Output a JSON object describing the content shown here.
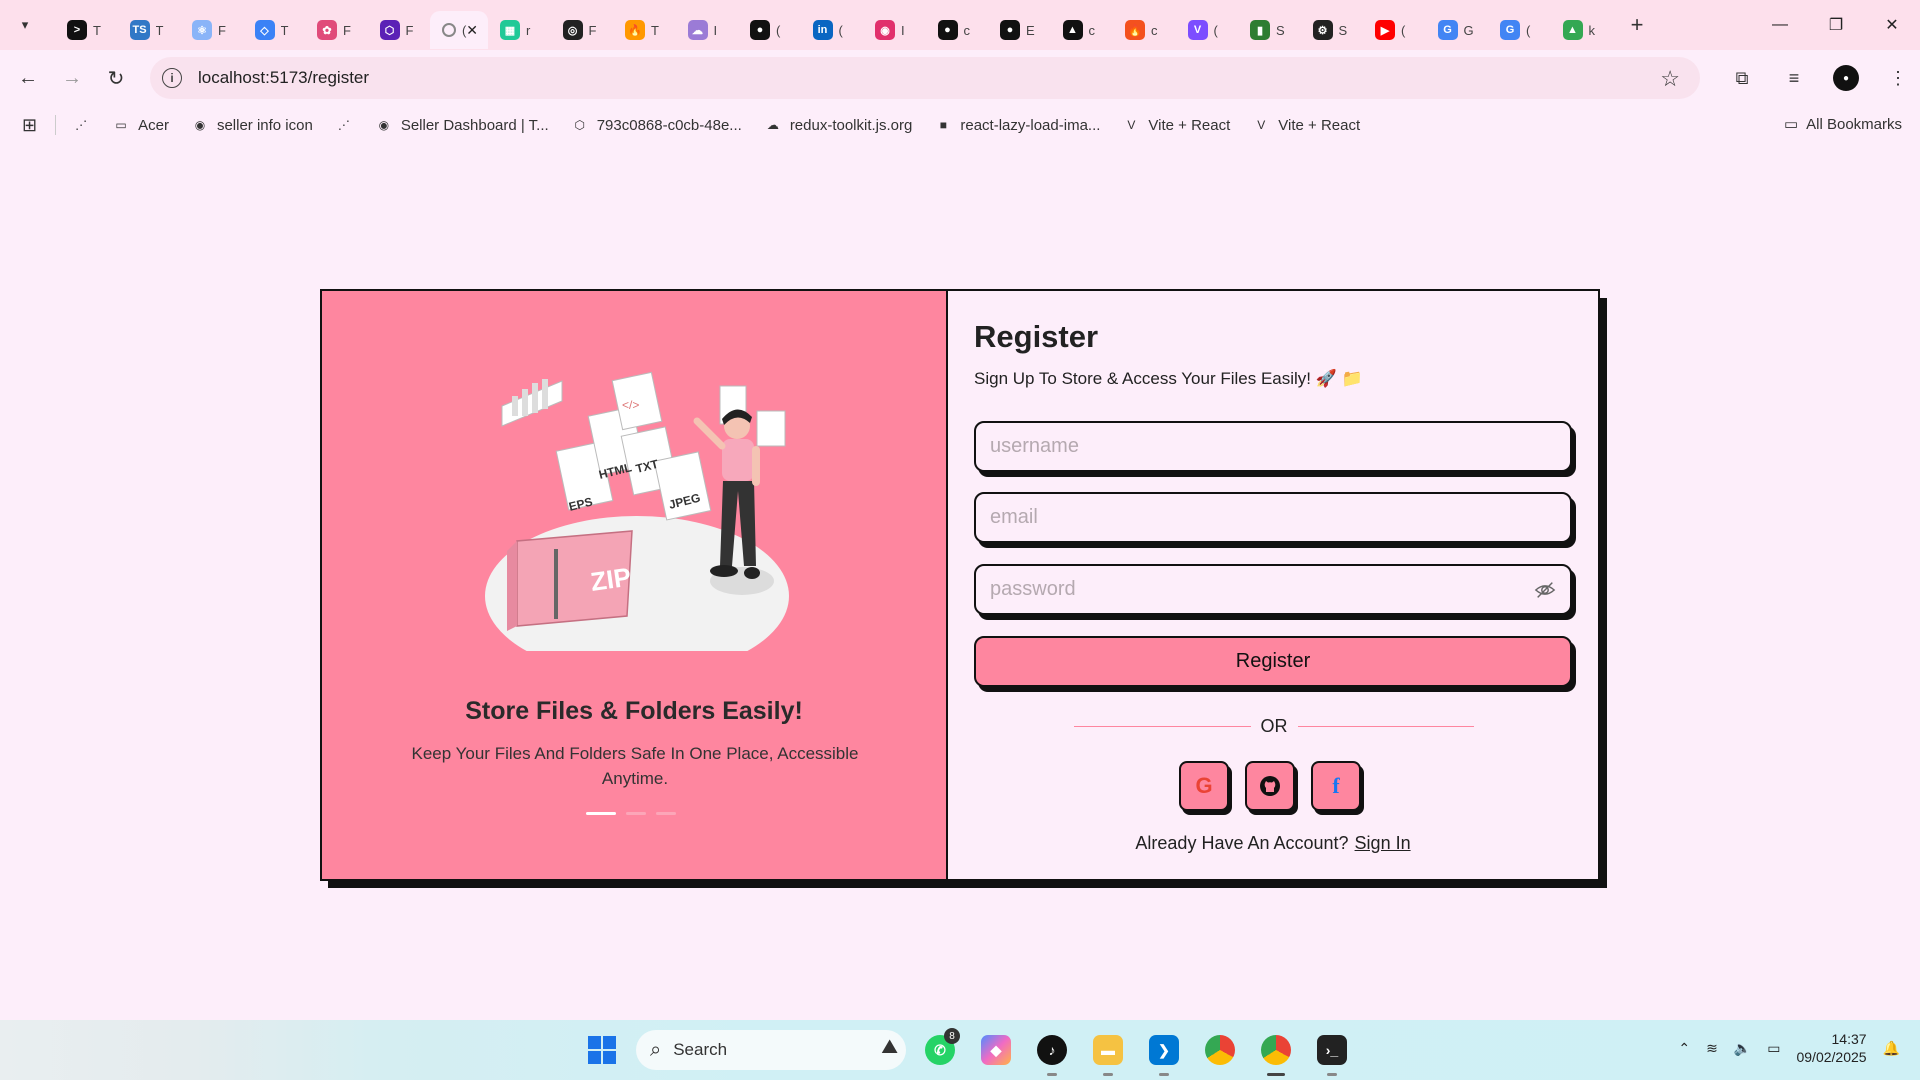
{
  "browser": {
    "tabs": [
      {
        "fav": ">",
        "label": "T",
        "color": "#111111"
      },
      {
        "fav": "TS",
        "label": "T",
        "color": "#3178c6"
      },
      {
        "fav": "⚛",
        "label": "F",
        "color": "#8ab4f8"
      },
      {
        "fav": "◇",
        "label": "T",
        "color": "#3b82f6"
      },
      {
        "fav": "✿",
        "label": "F",
        "color": "#e04b7a"
      },
      {
        "fav": "⬡",
        "label": "F",
        "color": "#5b21b6"
      },
      {
        "fav": "",
        "label": "(",
        "color": "#fdeefa",
        "active": true
      },
      {
        "fav": "▦",
        "label": "r",
        "color": "#20c997"
      },
      {
        "fav": "◎",
        "label": "F",
        "color": "#222222"
      },
      {
        "fav": "🔥",
        "label": "T",
        "color": "#ff9800"
      },
      {
        "fav": "☁",
        "label": "I",
        "color": "#9b7bd6"
      },
      {
        "fav": "●",
        "label": "(",
        "color": "#111111"
      },
      {
        "fav": "in",
        "label": "(",
        "color": "#0a66c2"
      },
      {
        "fav": "◉",
        "label": "I",
        "color": "#e1306c"
      },
      {
        "fav": "●",
        "label": "c",
        "color": "#111111"
      },
      {
        "fav": "●",
        "label": "E",
        "color": "#111111"
      },
      {
        "fav": "▲",
        "label": "c",
        "color": "#111111"
      },
      {
        "fav": "🔥",
        "label": "c",
        "color": "#f4511e"
      },
      {
        "fav": "V",
        "label": "(",
        "color": "#7c4dff"
      },
      {
        "fav": "▮",
        "label": "S",
        "color": "#2e7d32"
      },
      {
        "fav": "⚙",
        "label": "S",
        "color": "#222222"
      },
      {
        "fav": "▶",
        "label": "(",
        "color": "#ff0000"
      },
      {
        "fav": "G",
        "label": "G",
        "color": "#4285f4"
      },
      {
        "fav": "G",
        "label": "(",
        "color": "#4285f4"
      },
      {
        "fav": "▲",
        "label": "k",
        "color": "#34a853"
      }
    ],
    "url": "localhost:5173/register",
    "bookmarks": [
      {
        "label": "",
        "icon": "⋰"
      },
      {
        "label": "Acer",
        "icon": "▭"
      },
      {
        "label": "seller info icon",
        "icon": "◉"
      },
      {
        "label": "",
        "icon": "⋰"
      },
      {
        "label": "Seller Dashboard | T...",
        "icon": "◉"
      },
      {
        "label": "793c0868-c0cb-48e...",
        "icon": "⬡"
      },
      {
        "label": "redux-toolkit.js.org",
        "icon": "☁"
      },
      {
        "label": "react-lazy-load-ima...",
        "icon": "■"
      },
      {
        "label": "Vite + React",
        "icon": "V"
      },
      {
        "label": "Vite + React",
        "icon": "V"
      }
    ],
    "all_bookmarks": "All Bookmarks"
  },
  "left_panel": {
    "title": "Store Files & Folders Easily!",
    "description": "Keep Your Files And Folders Safe In One Place, Accessible Anytime.",
    "illustration_labels": [
      "EPS",
      "HTML",
      "TXT",
      "JPEG",
      "ZIP",
      "</>"
    ],
    "slide_index": 1,
    "slide_count": 3,
    "colors": {
      "panel": "#fe869f",
      "background": "#fdeefa",
      "border": "#111111"
    }
  },
  "form": {
    "title": "Register",
    "subtitle": "Sign Up To Store & Access Your Files Easily! 🚀 📁",
    "username_placeholder": "username",
    "email_placeholder": "email",
    "password_placeholder": "password",
    "register_label": "Register",
    "or_label": "OR",
    "socials": [
      {
        "name": "google",
        "glyph": "G"
      },
      {
        "name": "github",
        "glyph": "●"
      },
      {
        "name": "facebook",
        "glyph": "f"
      }
    ],
    "already_text": "Already Have An Account?",
    "signin_label": "Sign In"
  },
  "taskbar": {
    "search_label": "Search",
    "whatsapp_badge": "8",
    "time": "14:37",
    "date": "09/02/2025"
  }
}
